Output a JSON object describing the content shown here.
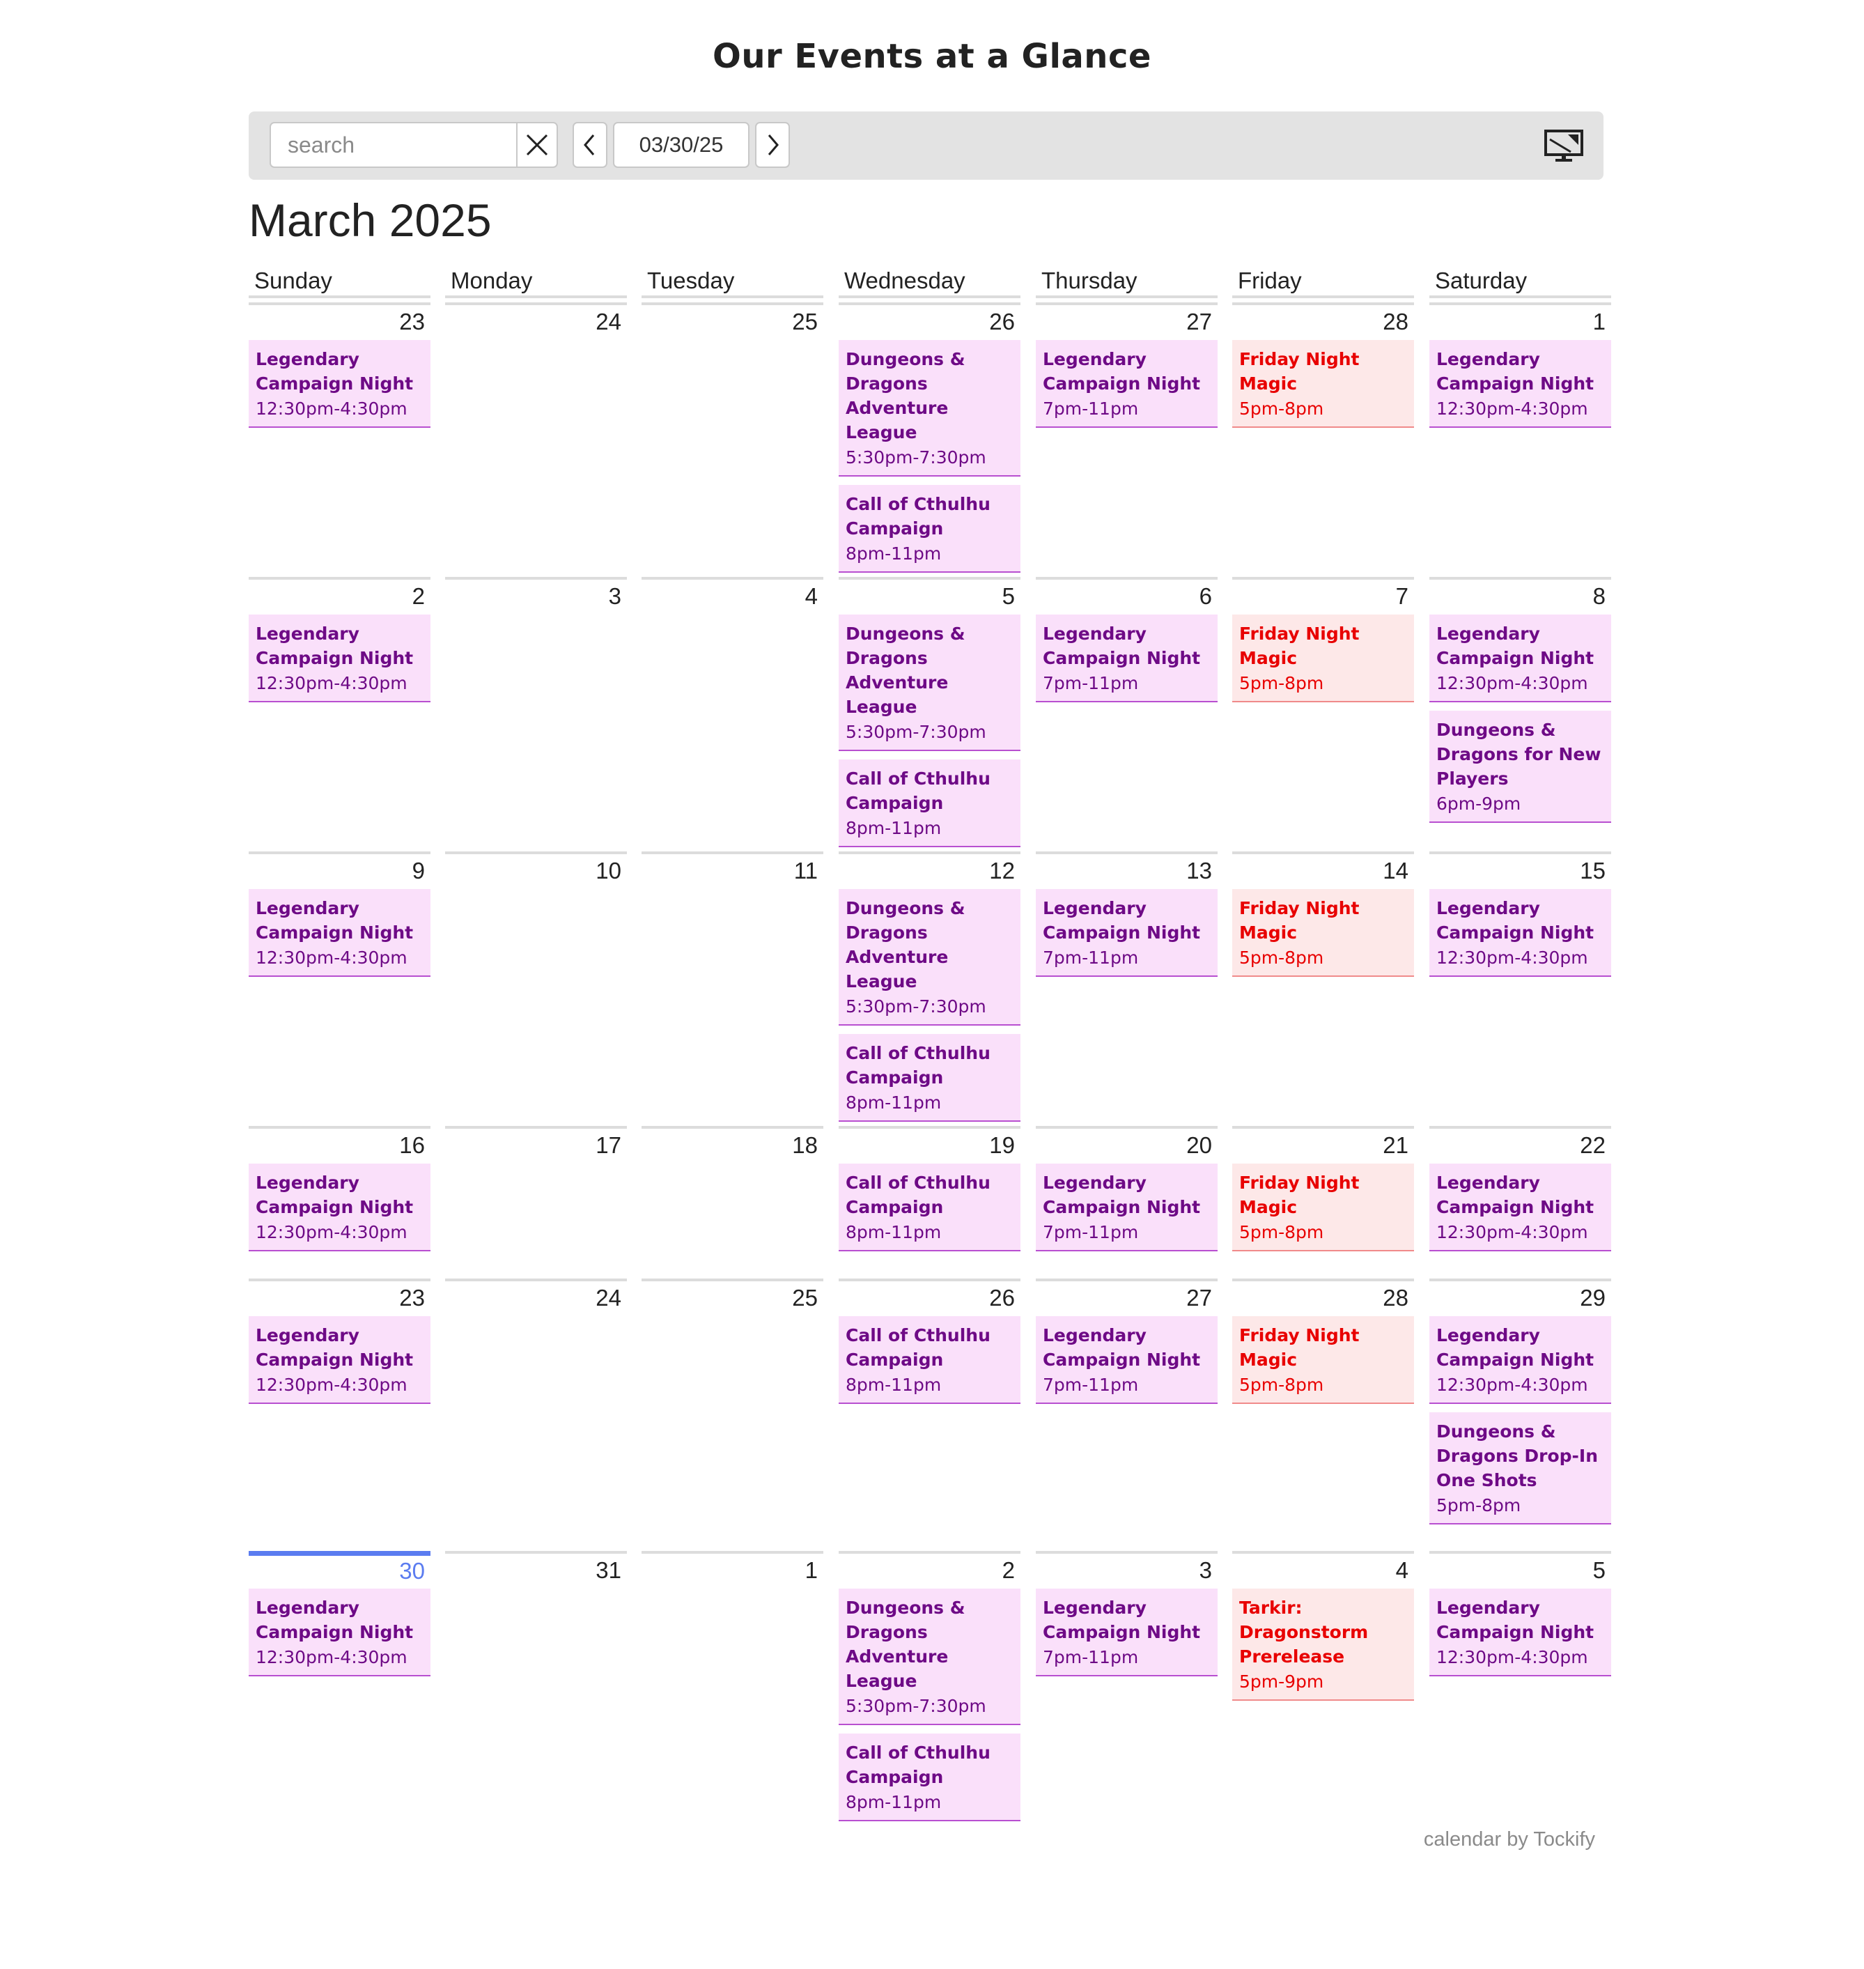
{
  "header": {
    "title": "Our Events at a Glance"
  },
  "toolbar": {
    "search_placeholder": "search",
    "search_value": "",
    "date": "03/30/25",
    "icons": {
      "clear": "close-icon",
      "prev": "chevron-left-icon",
      "next": "chevron-right-icon",
      "display": "monitor-icon"
    }
  },
  "month_title": "March 2025",
  "weekdays": [
    "Sunday",
    "Monday",
    "Tuesday",
    "Wednesday",
    "Thursday",
    "Friday",
    "Saturday"
  ],
  "colors": {
    "event_purple_bg": "#fae0fa",
    "event_purple_text": "#6e0a86",
    "event_red_bg": "#fde8e8",
    "event_red_text": "#e80000",
    "today_accent": "#5b7cf0"
  },
  "weeks": [
    {
      "days": [
        {
          "day": "23",
          "events": [
            {
              "title": "Legendary Campaign Night",
              "time": "12:30pm-4:30pm",
              "color": "purple"
            }
          ]
        },
        {
          "day": "24",
          "events": []
        },
        {
          "day": "25",
          "events": []
        },
        {
          "day": "26",
          "events": [
            {
              "title": "Dungeons & Dragons Adventure League",
              "time": "5:30pm-7:30pm",
              "color": "purple"
            },
            {
              "title": "Call of Cthulhu Campaign",
              "time": "8pm-11pm",
              "color": "purple"
            }
          ]
        },
        {
          "day": "27",
          "events": [
            {
              "title": "Legendary Campaign Night",
              "time": "7pm-11pm",
              "color": "purple"
            }
          ]
        },
        {
          "day": "28",
          "events": [
            {
              "title": "Friday Night Magic",
              "time": "5pm-8pm",
              "color": "red"
            }
          ]
        },
        {
          "day": "1",
          "events": [
            {
              "title": "Legendary Campaign Night",
              "time": "12:30pm-4:30pm",
              "color": "purple"
            }
          ]
        }
      ]
    },
    {
      "days": [
        {
          "day": "2",
          "events": [
            {
              "title": "Legendary Campaign Night",
              "time": "12:30pm-4:30pm",
              "color": "purple"
            }
          ]
        },
        {
          "day": "3",
          "events": []
        },
        {
          "day": "4",
          "events": []
        },
        {
          "day": "5",
          "events": [
            {
              "title": "Dungeons & Dragons Adventure League",
              "time": "5:30pm-7:30pm",
              "color": "purple"
            },
            {
              "title": "Call of Cthulhu Campaign",
              "time": "8pm-11pm",
              "color": "purple"
            }
          ]
        },
        {
          "day": "6",
          "events": [
            {
              "title": "Legendary Campaign Night",
              "time": "7pm-11pm",
              "color": "purple"
            }
          ]
        },
        {
          "day": "7",
          "events": [
            {
              "title": "Friday Night Magic",
              "time": "5pm-8pm",
              "color": "red"
            }
          ]
        },
        {
          "day": "8",
          "events": [
            {
              "title": "Legendary Campaign Night",
              "time": "12:30pm-4:30pm",
              "color": "purple"
            },
            {
              "title": "Dungeons & Dragons for New Players",
              "time": "6pm-9pm",
              "color": "purple"
            }
          ]
        }
      ]
    },
    {
      "days": [
        {
          "day": "9",
          "events": [
            {
              "title": "Legendary Campaign Night",
              "time": "12:30pm-4:30pm",
              "color": "purple"
            }
          ]
        },
        {
          "day": "10",
          "events": []
        },
        {
          "day": "11",
          "events": []
        },
        {
          "day": "12",
          "events": [
            {
              "title": "Dungeons & Dragons Adventure League",
              "time": "5:30pm-7:30pm",
              "color": "purple"
            },
            {
              "title": "Call of Cthulhu Campaign",
              "time": "8pm-11pm",
              "color": "purple"
            }
          ]
        },
        {
          "day": "13",
          "events": [
            {
              "title": "Legendary Campaign Night",
              "time": "7pm-11pm",
              "color": "purple"
            }
          ]
        },
        {
          "day": "14",
          "events": [
            {
              "title": "Friday Night Magic",
              "time": "5pm-8pm",
              "color": "red"
            }
          ]
        },
        {
          "day": "15",
          "events": [
            {
              "title": "Legendary Campaign Night",
              "time": "12:30pm-4:30pm",
              "color": "purple"
            }
          ]
        }
      ]
    },
    {
      "days": [
        {
          "day": "16",
          "events": [
            {
              "title": "Legendary Campaign Night",
              "time": "12:30pm-4:30pm",
              "color": "purple"
            }
          ]
        },
        {
          "day": "17",
          "events": []
        },
        {
          "day": "18",
          "events": []
        },
        {
          "day": "19",
          "events": [
            {
              "title": "Call of Cthulhu Campaign",
              "time": "8pm-11pm",
              "color": "purple"
            }
          ]
        },
        {
          "day": "20",
          "events": [
            {
              "title": "Legendary Campaign Night",
              "time": "7pm-11pm",
              "color": "purple"
            }
          ]
        },
        {
          "day": "21",
          "events": [
            {
              "title": "Friday Night Magic",
              "time": "5pm-8pm",
              "color": "red"
            }
          ]
        },
        {
          "day": "22",
          "events": [
            {
              "title": "Legendary Campaign Night",
              "time": "12:30pm-4:30pm",
              "color": "purple"
            }
          ]
        }
      ]
    },
    {
      "days": [
        {
          "day": "23",
          "events": [
            {
              "title": "Legendary Campaign Night",
              "time": "12:30pm-4:30pm",
              "color": "purple"
            }
          ]
        },
        {
          "day": "24",
          "events": []
        },
        {
          "day": "25",
          "events": []
        },
        {
          "day": "26",
          "events": [
            {
              "title": "Call of Cthulhu Campaign",
              "time": "8pm-11pm",
              "color": "purple"
            }
          ]
        },
        {
          "day": "27",
          "events": [
            {
              "title": "Legendary Campaign Night",
              "time": "7pm-11pm",
              "color": "purple"
            }
          ]
        },
        {
          "day": "28",
          "events": [
            {
              "title": "Friday Night Magic",
              "time": "5pm-8pm",
              "color": "red"
            }
          ]
        },
        {
          "day": "29",
          "events": [
            {
              "title": "Legendary Campaign Night",
              "time": "12:30pm-4:30pm",
              "color": "purple"
            },
            {
              "title": "Dungeons & Dragons Drop-In One Shots",
              "time": "5pm-8pm",
              "color": "purple"
            }
          ]
        }
      ]
    },
    {
      "days": [
        {
          "day": "30",
          "today": true,
          "events": [
            {
              "title": "Legendary Campaign Night",
              "time": "12:30pm-4:30pm",
              "color": "purple"
            }
          ]
        },
        {
          "day": "31",
          "events": []
        },
        {
          "day": "1",
          "events": []
        },
        {
          "day": "2",
          "events": [
            {
              "title": "Dungeons & Dragons Adventure League",
              "time": "5:30pm-7:30pm",
              "color": "purple"
            },
            {
              "title": "Call of Cthulhu Campaign",
              "time": "8pm-11pm",
              "color": "purple"
            }
          ]
        },
        {
          "day": "3",
          "events": [
            {
              "title": "Legendary Campaign Night",
              "time": "7pm-11pm",
              "color": "purple"
            }
          ]
        },
        {
          "day": "4",
          "events": [
            {
              "title": "Tarkir: Dragonstorm Prerelease",
              "time": "5pm-9pm",
              "color": "red"
            }
          ]
        },
        {
          "day": "5",
          "events": [
            {
              "title": "Legendary Campaign Night",
              "time": "12:30pm-4:30pm",
              "color": "purple"
            }
          ]
        }
      ]
    }
  ],
  "footer": {
    "credit": "calendar by Tockify"
  }
}
